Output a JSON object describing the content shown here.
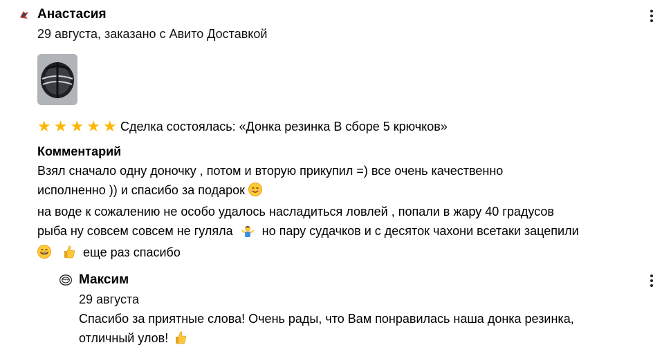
{
  "review": {
    "author": "Анастасия",
    "meta": "29 августа, заказано с Авито Доставкой",
    "rating": 5,
    "deal_text": "Сделка состоялась: «Донка резинка В сборе 5 крючков»",
    "comment_label": "Комментарий",
    "comment_line1": "Взял сначало одну доночку , потом и вторую прикупил =) все очень качественно",
    "comment_line2": "исполненно )) и спасибо за подарок",
    "comment_line3": "на воде к сожалению не особо удалось насладиться ловлей , попали в жару 40 градусов",
    "comment_line4a": "рыба ну совсем совсем не гуляла",
    "comment_line4b": "но пару судачков и с десяток чахони всетаки зацепили",
    "comment_line5": "еще раз спасибо"
  },
  "reply": {
    "author": "Максим",
    "date": "29 августа",
    "text_line1": "Спасибо за приятные слова! Очень рады, что Вам понравилась наша донка резинка,",
    "text_line2": "отличный улов!"
  },
  "colors": {
    "star": "#ffb400"
  },
  "icons": {
    "review_avatar": "avatar-icon",
    "reply_avatar": "avatar-icon",
    "more": "more-vertical-icon",
    "emojis": [
      "smiling-face-icon",
      "person-shrugging-icon",
      "grinning-face-icon",
      "thumbs-up-icon",
      "thumbs-up-icon"
    ]
  }
}
